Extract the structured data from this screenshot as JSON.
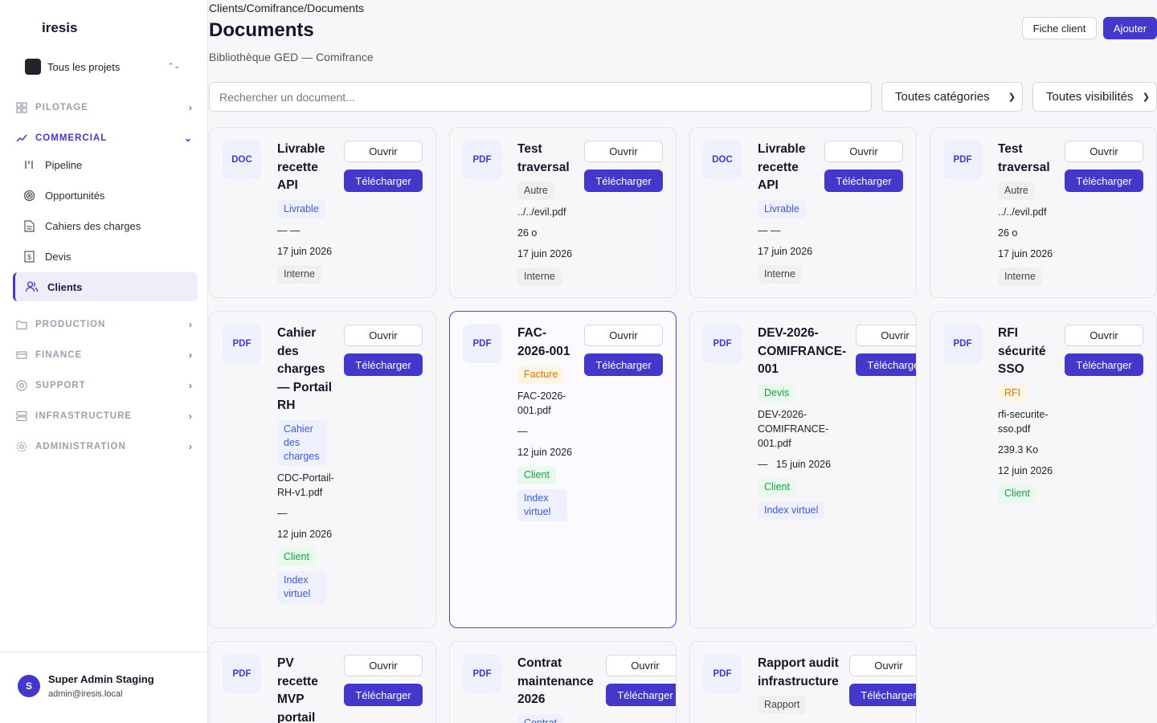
{
  "app": {
    "brand": "iresis",
    "project_selector": "Tous les projets"
  },
  "nav": {
    "groups": [
      "PILOTAGE",
      "COMMERCIAL",
      "PRODUCTION",
      "FINANCE",
      "SUPPORT",
      "INFRASTRUCTURE",
      "ADMINISTRATION"
    ],
    "commercial_items": [
      "Pipeline",
      "Opportunités",
      "Cahiers des charges",
      "Devis",
      "Clients"
    ]
  },
  "user": {
    "initial": "S",
    "name": "Super Admin Staging",
    "email": "admin@iresis.local"
  },
  "page": {
    "breadcrumb": "Clients/Comifrance/Documents",
    "title": "Documents",
    "subtitle": "Bibliothèque GED — Comifrance",
    "btn_client": "Fiche client",
    "btn_add": "Ajouter"
  },
  "filters": {
    "search_placeholder": "Rechercher un document...",
    "category": "Toutes catégories",
    "visibility": "Toutes visibilités"
  },
  "card_actions": {
    "open": "Ouvrir",
    "download": "Télécharger"
  },
  "documents": [
    {
      "type": "DOC",
      "title": "Livrable recette API",
      "category": "Livrable",
      "file": "— —",
      "date": "17 juin 2026",
      "visibility": "Interne"
    },
    {
      "type": "PDF",
      "title": "Test traversal",
      "category": "Autre",
      "file": "../../evil.pdf",
      "size": "26 o",
      "date": "17 juin 2026",
      "visibility": "Interne"
    },
    {
      "type": "DOC",
      "title": "Livrable recette API",
      "category": "Livrable",
      "file": "— —",
      "date": "17 juin 2026",
      "visibility": "Interne"
    },
    {
      "type": "PDF",
      "title": "Test traversal",
      "category": "Autre",
      "file": "../../evil.pdf",
      "size": "26 o",
      "date": "17 juin 2026",
      "visibility": "Interne"
    },
    {
      "type": "PDF",
      "title": "Cahier des charges — Portail RH",
      "category": "Cahier des charges",
      "file": "CDC-Portail-RH-v1.pdf",
      "size": "—",
      "date": "12 juin 2026",
      "visibility": "Client",
      "index": "Index virtuel"
    },
    {
      "type": "PDF",
      "title": "FAC-2026-001",
      "category": "Facture",
      "file": "FAC-2026-001.pdf",
      "size": "—",
      "date": "12 juin 2026",
      "visibility": "Client",
      "index": "Index virtuel"
    },
    {
      "type": "PDF",
      "title": "DEV-2026-COMIFRANCE-001",
      "category": "Devis",
      "file": "DEV-2026-COMIFRANCE-001.pdf",
      "size": "—",
      "date": "15 juin 2026",
      "visibility": "Client",
      "index": "Index virtuel"
    },
    {
      "type": "PDF",
      "title": "RFI sécurité SSO",
      "category": "RFI",
      "file": "rfi-securite-sso.pdf",
      "size": "239.3 Ko",
      "date": "12 juin 2026",
      "visibility": "Client"
    },
    {
      "type": "PDF",
      "title": "PV recette MVP portail"
    },
    {
      "type": "PDF",
      "title": "Contrat maintenance 2026",
      "category": "Contrat"
    },
    {
      "type": "PDF",
      "title": "Rapport audit infrastructure",
      "category": "Rapport"
    }
  ],
  "colors": {
    "accent": "#4338ca"
  }
}
